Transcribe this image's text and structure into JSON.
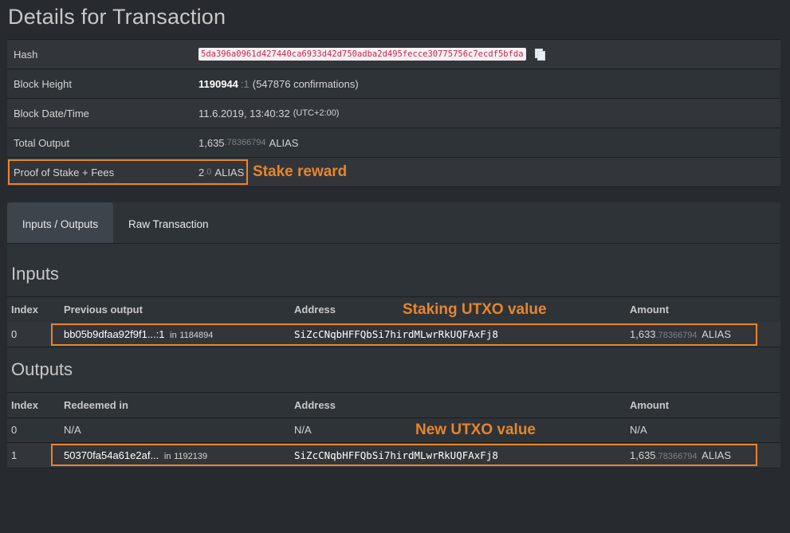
{
  "page": {
    "title": "Details for Transaction"
  },
  "details": {
    "hash_label": "Hash",
    "hash_value": "5da396a0961d427440ca6933d42d750adba2d495fecce30775756c7ecdf5bfda",
    "block_height_label": "Block Height",
    "block_height_value": "1190944",
    "block_height_suffix": ":1",
    "block_height_confirmations": "(547876 confirmations)",
    "block_date_label": "Block Date/Time",
    "block_date_value": "11.6.2019, 13:40:32",
    "block_date_tz": "(UTC+2:00)",
    "total_output_label": "Total Output",
    "total_output_int": "1,635",
    "total_output_dec": ".78366794",
    "total_output_unit": "ALIAS",
    "pos_label": "Proof of Stake + Fees",
    "pos_int": "2",
    "pos_dec": ".0",
    "pos_unit": "ALIAS"
  },
  "annotations": {
    "stake_reward": "Stake reward",
    "staking_utxo": "Staking UTXO value",
    "new_utxo": "New UTXO value"
  },
  "tabs": [
    {
      "label": "Inputs / Outputs",
      "active": true
    },
    {
      "label": "Raw Transaction",
      "active": false
    }
  ],
  "inputs": {
    "title": "Inputs",
    "headers": [
      "Index",
      "Previous output",
      "Address",
      "Amount"
    ],
    "rows": [
      {
        "index": "0",
        "prev_output": "bb05b9dfaa92f9f1...:1",
        "in_label": "in",
        "in_block": "1184894",
        "address": "SiZcCNqbHFFQbSi7hirdMLwrRkUQFAxFj8",
        "amount_int": "1,633",
        "amount_dec": ".78366794",
        "amount_unit": "ALIAS"
      }
    ]
  },
  "outputs": {
    "title": "Outputs",
    "headers": [
      "Index",
      "Redeemed in",
      "Address",
      "Amount"
    ],
    "rows": [
      {
        "index": "0",
        "redeemed": "N/A",
        "address": "N/A",
        "amount": "N/A"
      },
      {
        "index": "1",
        "redeemed": "50370fa54a61e2af...",
        "in_label": "in",
        "in_block": "1192139",
        "address": "SiZcCNqbHFFQbSi7hirdMLwrRkUQFAxFj8",
        "amount_int": "1,635",
        "amount_dec": ".78366794",
        "amount_unit": "ALIAS"
      }
    ]
  },
  "colors": {
    "background": "#272b30",
    "highlight": "#e8852a",
    "hash_text": "#c7254e"
  }
}
